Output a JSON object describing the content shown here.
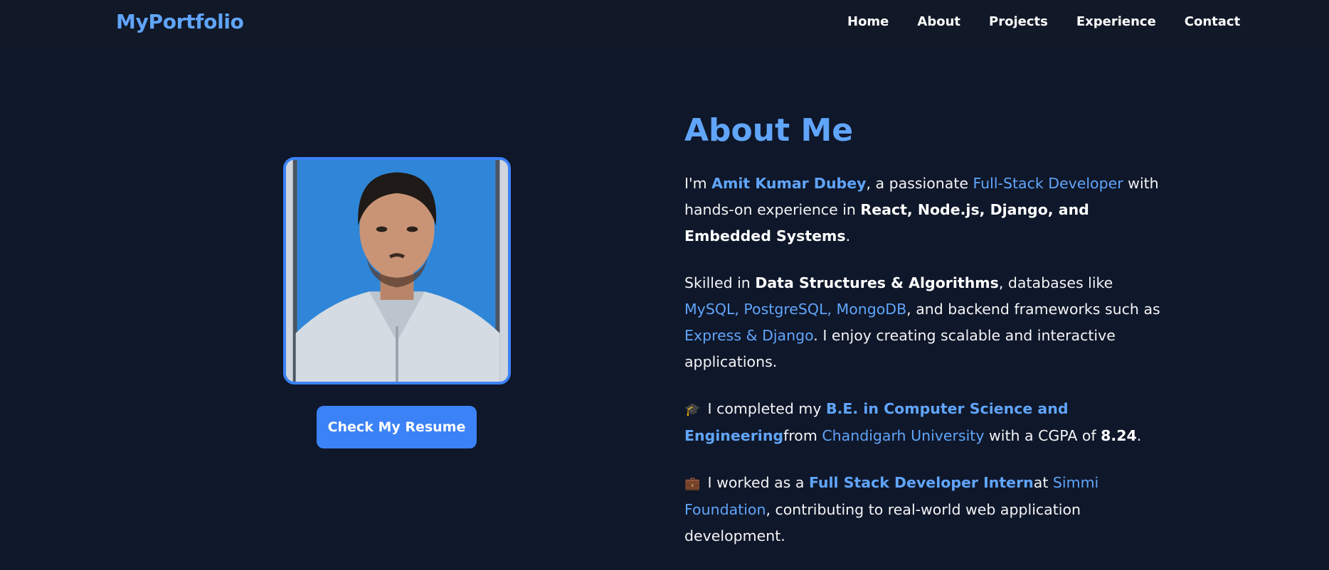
{
  "nav": {
    "logo": "MyPortfolio",
    "links": [
      "Home",
      "About",
      "Projects",
      "Experience",
      "Contact"
    ]
  },
  "profile": {
    "resume_button": "Check My Resume"
  },
  "about": {
    "title": "About Me",
    "p1": {
      "t1": "I'm ",
      "name": "Amit Kumar Dubey",
      "t2": ", a passionate ",
      "role": "Full-Stack Developer",
      "t3": " with hands-on experience in ",
      "skills": "React, Node.js, Django, and Embedded Systems",
      "t4": "."
    },
    "p2": {
      "t1": "Skilled in ",
      "dsa": "Data Structures & Algorithms",
      "t2": ", databases like ",
      "dbs": "MySQL, PostgreSQL, MongoDB",
      "t3": ", and backend frameworks such as ",
      "frameworks": "Express & Django",
      "t4": ". I enjoy creating scalable and interactive applications."
    },
    "p3": {
      "icon": "🎓",
      "t1": " I completed my ",
      "degree": "B.E. in Computer Science and Engineering",
      "t2": "from ",
      "university": "Chandigarh University",
      "t3": " with a CGPA of ",
      "cgpa": "8.24",
      "t4": "."
    },
    "p4": {
      "icon": "💼",
      "t1": " I worked as a ",
      "position": "Full Stack Developer Intern",
      "t2": "at ",
      "company": "Simmi Foundation",
      "t3": ", contributing to real-world web application development."
    }
  },
  "colors": {
    "background": "#0f172a",
    "navbar": "#111827",
    "accent": "#3b82f6",
    "link": "#60a5fa"
  }
}
